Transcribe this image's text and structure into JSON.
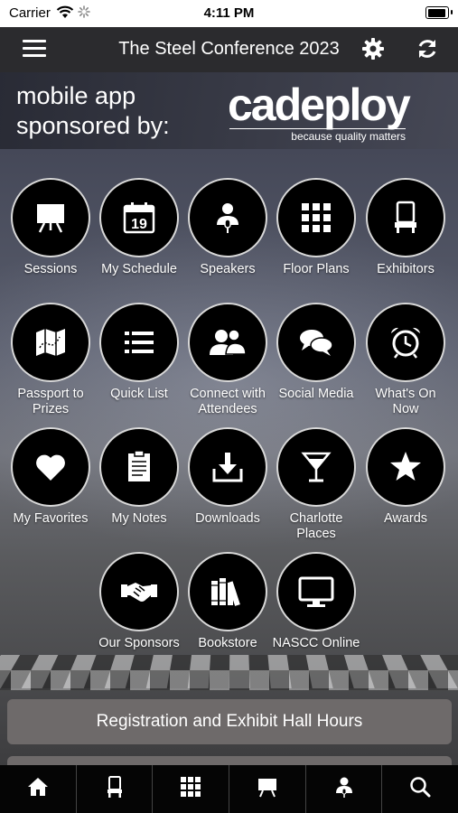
{
  "status_bar": {
    "carrier": "Carrier",
    "time": "4:11 PM"
  },
  "nav": {
    "title": "The Steel Conference 2023"
  },
  "banner": {
    "line1": "mobile app",
    "line2": "sponsored by:",
    "brand": "cadeploy",
    "tagline": "because quality matters"
  },
  "tiles": [
    {
      "label": "Sessions",
      "icon": "easel-icon"
    },
    {
      "label": "My Schedule",
      "icon": "calendar-icon",
      "calendar_day": "19"
    },
    {
      "label": "Speakers",
      "icon": "speaker-icon"
    },
    {
      "label": "Floor Plans",
      "icon": "floor-plan-icon"
    },
    {
      "label": "Exhibitors",
      "icon": "booth-icon"
    },
    {
      "label": "Passport to Prizes",
      "icon": "map-icon"
    },
    {
      "label": "Quick List",
      "icon": "list-icon"
    },
    {
      "label": "Connect with Attendees",
      "icon": "people-icon"
    },
    {
      "label": "Social Media",
      "icon": "chat-icon"
    },
    {
      "label": "What's On Now",
      "icon": "alarm-clock-icon"
    },
    {
      "label": "My Favorites",
      "icon": "heart-icon"
    },
    {
      "label": "My Notes",
      "icon": "notepad-icon"
    },
    {
      "label": "Downloads",
      "icon": "download-icon"
    },
    {
      "label": "Charlotte Places",
      "icon": "cocktail-icon"
    },
    {
      "label": "Awards",
      "icon": "star-icon"
    },
    {
      "label": "Our Sponsors",
      "icon": "handshake-icon"
    },
    {
      "label": "Bookstore",
      "icon": "books-icon"
    },
    {
      "label": "NASCC Online",
      "icon": "monitor-icon"
    }
  ],
  "registration_button": "Registration and Exhibit Hall Hours",
  "tab_bar": [
    "home-icon",
    "booth-icon",
    "floor-plan-icon",
    "easel-icon",
    "speaker-icon",
    "search-icon"
  ],
  "colors": {
    "nav_bg": "#2b2b2e",
    "tile_bg": "#000000",
    "button_bg": "#6e6a6a",
    "tab_bg": "#050505"
  }
}
